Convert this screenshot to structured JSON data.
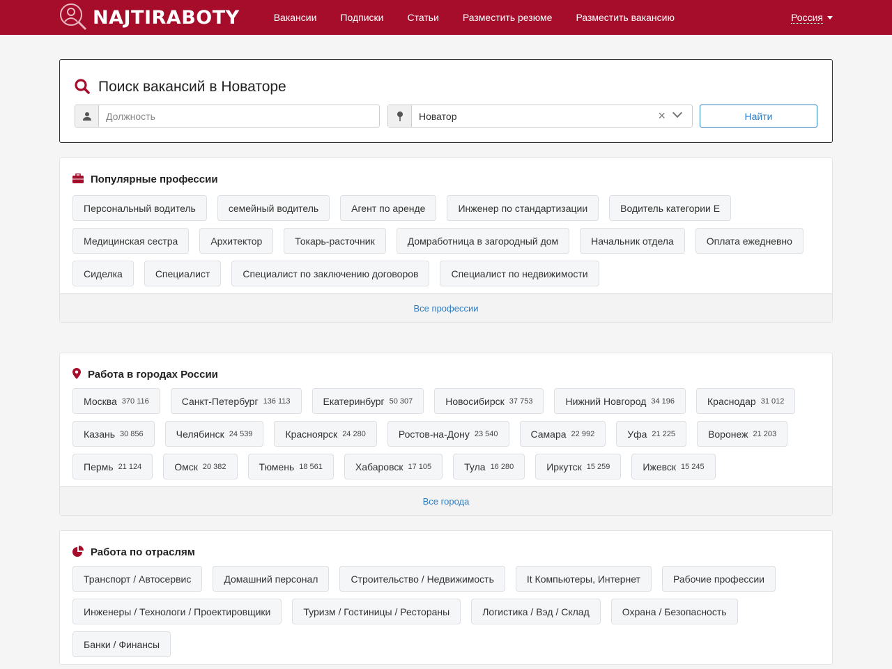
{
  "header": {
    "logo_text": "NAJTIRABOTY",
    "nav": [
      "Вакансии",
      "Подписки",
      "Статьи",
      "Разместить резюме",
      "Разместить вакансию"
    ],
    "region": "Россия"
  },
  "search": {
    "title": "Поиск вакансий в Новаторе",
    "position_placeholder": "Должность",
    "city_value": "Новатор",
    "find_button": "Найти"
  },
  "professions": {
    "title": "Популярные профессии",
    "items": [
      "Персональный водитель",
      "семейный водитель",
      "Агент по аренде",
      "Инженер по стандартизации",
      "Водитель категории Е",
      "Медицинская сестра",
      "Архитектор",
      "Токарь-расточник",
      "Домработница в загородный дом",
      "Начальник отдела",
      "Оплата ежедневно",
      "Сиделка",
      "Специалист",
      "Специалист по заключению договоров",
      "Специалист по недвижимости"
    ],
    "footer_link": "Все профессии"
  },
  "cities": {
    "title": "Работа в городах России",
    "items": [
      {
        "name": "Москва",
        "count": "370 116"
      },
      {
        "name": "Санкт-Петербург",
        "count": "136 113"
      },
      {
        "name": "Екатеринбург",
        "count": "50 307"
      },
      {
        "name": "Новосибирск",
        "count": "37 753"
      },
      {
        "name": "Нижний Новгород",
        "count": "34 196"
      },
      {
        "name": "Краснодар",
        "count": "31 012"
      },
      {
        "name": "Казань",
        "count": "30 856"
      },
      {
        "name": "Челябинск",
        "count": "24 539"
      },
      {
        "name": "Красноярск",
        "count": "24 280"
      },
      {
        "name": "Ростов-на-Дону",
        "count": "23 540"
      },
      {
        "name": "Самара",
        "count": "22 992"
      },
      {
        "name": "Уфа",
        "count": "21 225"
      },
      {
        "name": "Воронеж",
        "count": "21 203"
      },
      {
        "name": "Пермь",
        "count": "21 124"
      },
      {
        "name": "Омск",
        "count": "20 382"
      },
      {
        "name": "Тюмень",
        "count": "18 561"
      },
      {
        "name": "Хабаровск",
        "count": "17 105"
      },
      {
        "name": "Тула",
        "count": "16 280"
      },
      {
        "name": "Иркутск",
        "count": "15 259"
      },
      {
        "name": "Ижевск",
        "count": "15 245"
      }
    ],
    "footer_link": "Все города"
  },
  "industries": {
    "title": "Работа по отраслям",
    "items": [
      "Транспорт / Автосервис",
      "Домашний персонал",
      "Строительство / Недвижимость",
      "It Компьютеры, Интернет",
      "Рабочие профессии",
      "Инженеры / Технологи / Проектировщики",
      "Туризм / Гостиницы / Рестораны",
      "Логистика / Вэд / Склад",
      "Охрана / Безопасность",
      "Банки / Финансы"
    ]
  },
  "colors": {
    "brand": "#a50d2b",
    "link": "#2c7cc4"
  },
  "icons": {
    "logo": "magnifier-person-icon",
    "position": "user-icon",
    "city": "map-pin-icon",
    "search": "search-icon",
    "professions": "briefcase-icon",
    "cities": "map-marker-icon",
    "industries": "pie-chart-icon"
  }
}
